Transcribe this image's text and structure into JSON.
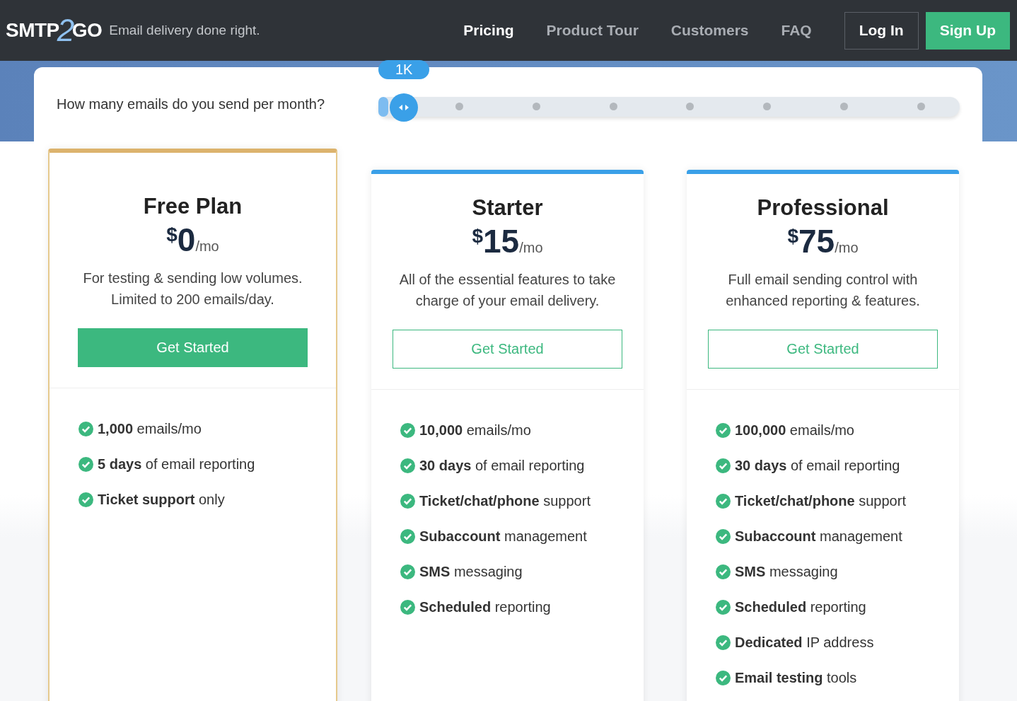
{
  "header": {
    "logo": {
      "left": "SMTP",
      "mid": "2",
      "right": "GO"
    },
    "tagline": "Email delivery done right.",
    "nav": [
      {
        "label": "Pricing",
        "selected": true
      },
      {
        "label": "Product Tour",
        "selected": false
      },
      {
        "label": "Customers",
        "selected": false
      },
      {
        "label": "FAQ",
        "selected": false
      }
    ],
    "login": "Log In",
    "signup": "Sign Up"
  },
  "volume": {
    "question": "How many emails do you send per month?",
    "value": "1K",
    "level": 0
  },
  "plans": [
    {
      "name": "Free Plan",
      "currency": "$",
      "price": "0",
      "period": "/mo",
      "description": "For testing & sending low volumes. Limited to 200 emails/day.",
      "button": "Get Started",
      "selected": true,
      "features": [
        "**1,000** emails/mo",
        "**5 days** of email reporting",
        "**Ticket support** only"
      ]
    },
    {
      "name": "Starter",
      "currency": "$",
      "price": "15",
      "period": "/mo",
      "description": "All of the essential features to take charge of your email delivery.",
      "button": "Get Started",
      "selected": false,
      "features": [
        "**10,000** emails/mo",
        "**30 days** of email reporting",
        "**Ticket/chat/phone** support",
        "**Subaccount** management",
        "**SMS** messaging",
        "**Scheduled** reporting"
      ]
    },
    {
      "name": "Professional",
      "currency": "$",
      "price": "75",
      "period": "/mo",
      "description": "Full email sending control with enhanced reporting & features.",
      "button": "Get Started",
      "selected": false,
      "features": [
        "**100,000** emails/mo",
        "**30 days** of email reporting",
        "**Ticket/chat/phone** support",
        "**Subaccount** management",
        "**SMS** messaging",
        "**Scheduled** reporting",
        "**Dedicated** IP address",
        "**Email testing** tools"
      ]
    }
  ]
}
